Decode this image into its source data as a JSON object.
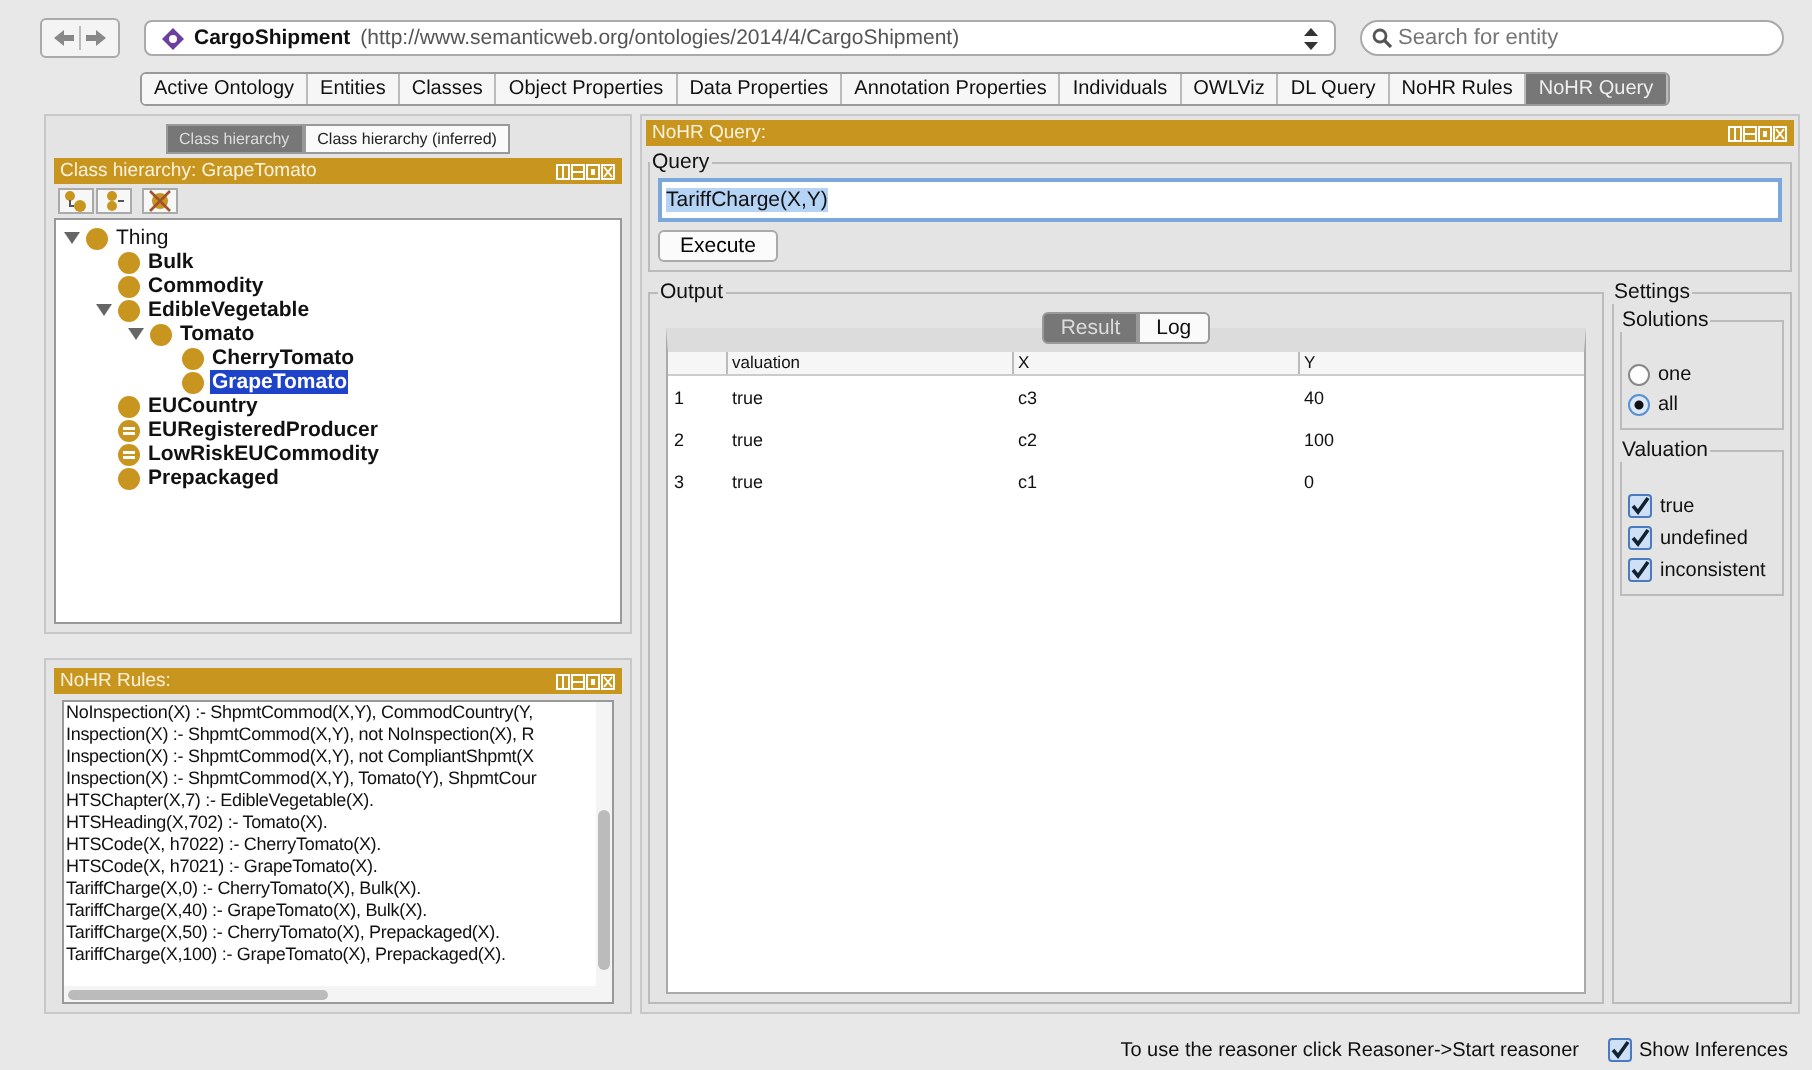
{
  "toolbar": {
    "ontology_name": "CargoShipment",
    "ontology_iri": "(http://www.semanticweb.org/ontologies/2014/4/CargoShipment)",
    "search_placeholder": "Search for entity"
  },
  "tabs": [
    {
      "label": "Active Ontology",
      "selected": false
    },
    {
      "label": "Entities",
      "selected": false
    },
    {
      "label": "Classes",
      "selected": false
    },
    {
      "label": "Object Properties",
      "selected": false
    },
    {
      "label": "Data Properties",
      "selected": false
    },
    {
      "label": "Annotation Properties",
      "selected": false
    },
    {
      "label": "Individuals",
      "selected": false
    },
    {
      "label": "OWLViz",
      "selected": false
    },
    {
      "label": "DL Query",
      "selected": false
    },
    {
      "label": "NoHR Rules",
      "selected": false
    },
    {
      "label": "NoHR Query",
      "selected": true
    }
  ],
  "class_hierarchy": {
    "view_tabs": [
      {
        "label": "Class hierarchy",
        "selected": true
      },
      {
        "label": "Class hierarchy (inferred)",
        "selected": false
      }
    ],
    "title": "Class hierarchy: GrapeTomato",
    "tree": [
      {
        "label": "Thing",
        "kind": "top",
        "selected": false,
        "expanded": true,
        "children": [
          {
            "label": "Bulk",
            "kind": "class",
            "selected": false
          },
          {
            "label": "Commodity",
            "kind": "class",
            "selected": false
          },
          {
            "label": "EdibleVegetable",
            "kind": "class",
            "selected": false,
            "expanded": true,
            "children": [
              {
                "label": "Tomato",
                "kind": "class",
                "selected": false,
                "expanded": true,
                "children": [
                  {
                    "label": "CherryTomato",
                    "kind": "class",
                    "selected": false
                  },
                  {
                    "label": "GrapeTomato",
                    "kind": "class",
                    "selected": true
                  }
                ]
              }
            ]
          },
          {
            "label": "EUCountry",
            "kind": "class",
            "selected": false
          },
          {
            "label": "EURegisteredProducer",
            "kind": "defined",
            "selected": false
          },
          {
            "label": "LowRiskEUCommodity",
            "kind": "defined",
            "selected": false
          },
          {
            "label": "Prepackaged",
            "kind": "class",
            "selected": false
          }
        ]
      }
    ]
  },
  "rules_panel": {
    "title": "NoHR Rules:",
    "rules": [
      "NoInspection(X) :- ShpmtCommod(X,Y), CommodCountry(Y,",
      "Inspection(X) :- ShpmtCommod(X,Y), not NoInspection(X), R",
      "Inspection(X) :- ShpmtCommod(X,Y), not CompliantShpmt(X",
      "Inspection(X) :- ShpmtCommod(X,Y), Tomato(Y), ShpmtCour",
      "HTSChapter(X,7) :- EdibleVegetable(X).",
      "HTSHeading(X,702) :- Tomato(X).",
      "HTSCode(X, h7022) :- CherryTomato(X).",
      "HTSCode(X, h7021) :- GrapeTomato(X).",
      "TariffCharge(X,0) :- CherryTomato(X), Bulk(X).",
      "TariffCharge(X,40) :- GrapeTomato(X), Bulk(X).",
      "TariffCharge(X,50) :- CherryTomato(X), Prepackaged(X).",
      "TariffCharge(X,100) :- GrapeTomato(X), Prepackaged(X)."
    ]
  },
  "query_panel": {
    "title": "NoHR Query:",
    "query_group": "Query",
    "query": "TariffCharge(X,Y)",
    "execute": "Execute",
    "output_group": "Output",
    "output_tabs": [
      {
        "label": "Result",
        "selected": true
      },
      {
        "label": "Log",
        "selected": false
      }
    ],
    "table": {
      "columns": [
        "valuation",
        "X",
        "Y"
      ],
      "rows": [
        {
          "number": "1",
          "cells": [
            "true",
            "c3",
            "40"
          ]
        },
        {
          "number": "2",
          "cells": [
            "true",
            "c2",
            "100"
          ]
        },
        {
          "number": "3",
          "cells": [
            "true",
            "c1",
            "0"
          ]
        }
      ]
    }
  },
  "settings": {
    "title": "Settings",
    "solutions_title": "Solutions",
    "solutions": [
      {
        "label": "one",
        "selected": false
      },
      {
        "label": "all",
        "selected": true
      }
    ],
    "valuation_title": "Valuation",
    "valuation": [
      {
        "label": "true",
        "checked": true
      },
      {
        "label": "undefined",
        "checked": true
      },
      {
        "label": "inconsistent",
        "checked": true
      }
    ]
  },
  "status_bar": {
    "message": "To use the reasoner click Reasoner->Start reasoner",
    "show_inferences": {
      "label": "Show Inferences",
      "checked": true
    }
  }
}
